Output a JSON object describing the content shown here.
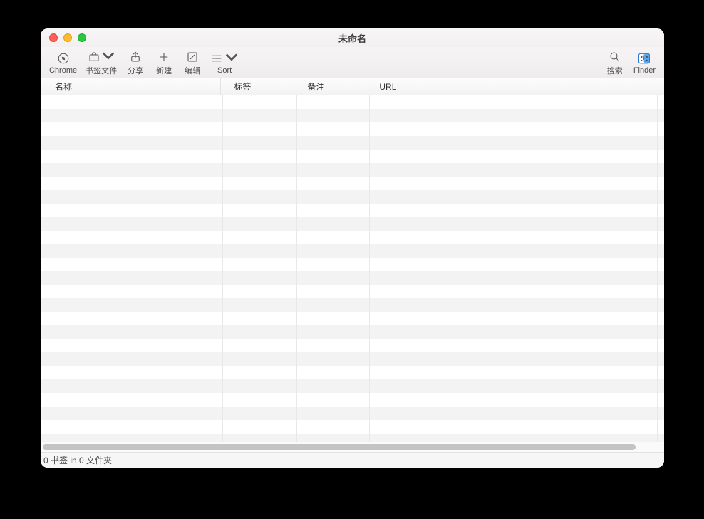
{
  "window": {
    "title": "未命名"
  },
  "toolbar": {
    "left": [
      {
        "name": "chrome",
        "label": "Chrome",
        "icon": "compass-icon"
      },
      {
        "name": "bookmark-files",
        "label": "书签文件",
        "icon": "briefcase-icon",
        "chevron": true
      },
      {
        "name": "share",
        "label": "分享",
        "icon": "share-icon"
      },
      {
        "name": "new",
        "label": "新建",
        "icon": "plus-icon"
      },
      {
        "name": "edit",
        "label": "编辑",
        "icon": "edit-icon"
      },
      {
        "name": "sort",
        "label": "Sort",
        "icon": "list-icon",
        "chevron": true
      }
    ],
    "right": [
      {
        "name": "search",
        "label": "搜索",
        "icon": "search-icon"
      },
      {
        "name": "finder",
        "label": "Finder",
        "icon": "finder-icon"
      }
    ]
  },
  "columns": {
    "c1": "名称",
    "c2": "标签",
    "c3": "备注",
    "c4": "URL",
    "c5": ""
  },
  "rows": [
    {},
    {},
    {},
    {},
    {},
    {},
    {},
    {},
    {},
    {},
    {},
    {},
    {},
    {},
    {},
    {},
    {},
    {},
    {},
    {},
    {},
    {},
    {},
    {},
    {},
    {}
  ],
  "status": "0 书签 in 0 文件夹"
}
